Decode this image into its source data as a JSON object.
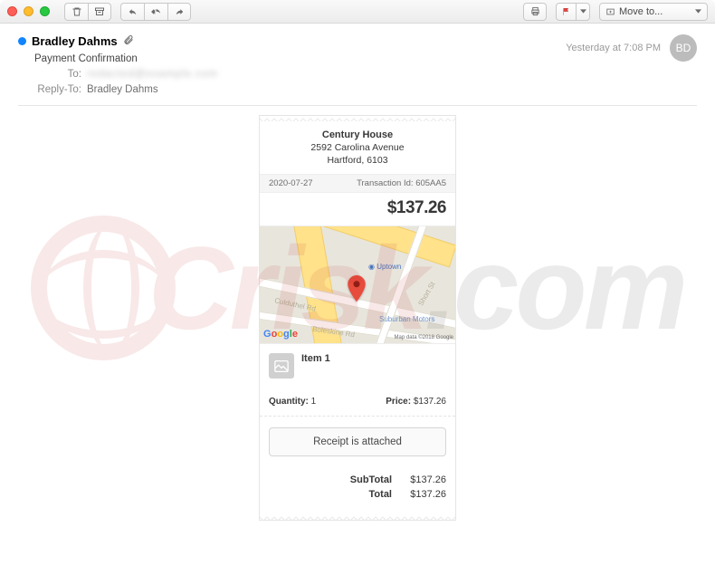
{
  "toolbar": {
    "move_to_label": "Move to..."
  },
  "header": {
    "sender": "Bradley Dahms",
    "subject": "Payment Confirmation",
    "to_label": "To:",
    "to_value": "redacted@example.com",
    "reply_to_label": "Reply-To:",
    "reply_to_value": "Bradley Dahms",
    "timestamp": "Yesterday at 7:08 PM",
    "avatar_initials": "BD"
  },
  "receipt": {
    "merchant": "Century House",
    "address1": "2592 Carolina Avenue",
    "address2": "Hartford, 6103",
    "date": "2020-07-27",
    "txn_label": "Transaction Id:",
    "txn_id": "605AA5",
    "amount": "$137.26",
    "map": {
      "label_uptown": "Uptown",
      "label_sub": "Suburban Motors",
      "road_culduthel": "Culduthel Rd",
      "road_boleskine": "Boleskine Rd",
      "road_short": "Short St",
      "attribution": "Map data ©2018 Google"
    },
    "item": {
      "name": "Item 1",
      "qty_label": "Quantity:",
      "qty_value": "1",
      "price_label": "Price:",
      "price_value": "$137.26"
    },
    "button_label": "Receipt is attached",
    "subtotal_label": "SubTotal",
    "subtotal_value": "$137.26",
    "total_label": "Total",
    "total_value": "$137.26"
  },
  "watermark": "PCrisk.com"
}
